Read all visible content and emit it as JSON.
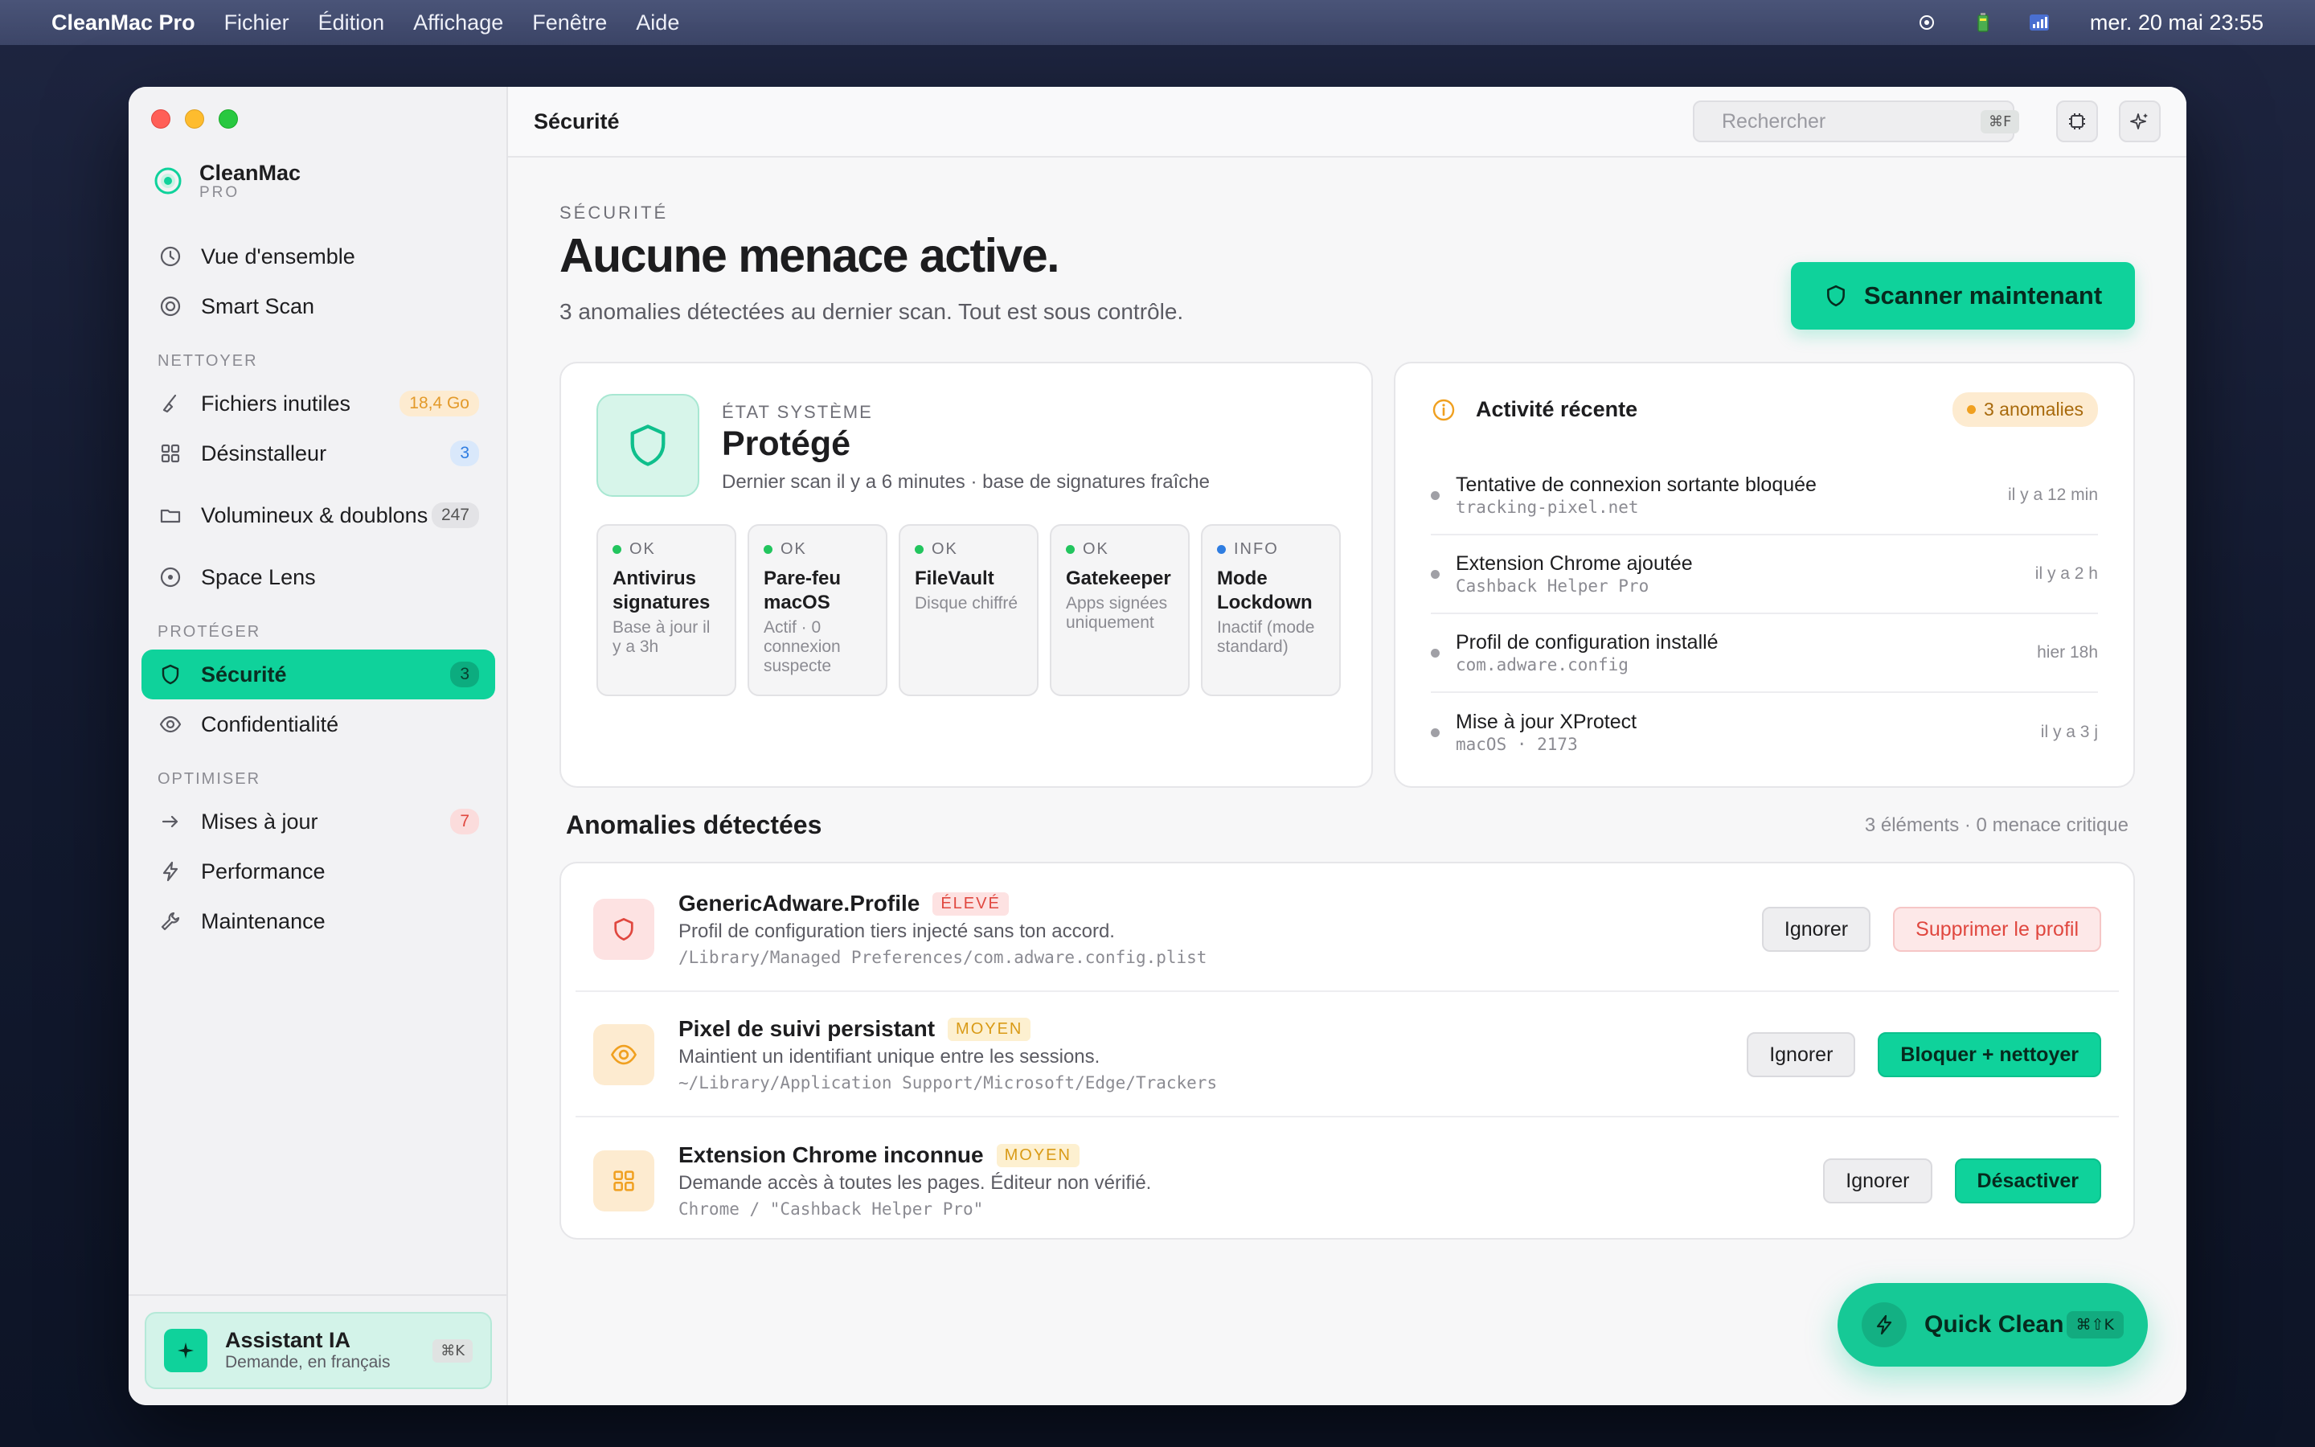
{
  "menubar": {
    "app_name": "CleanMac Pro",
    "menus": [
      "Fichier",
      "Édition",
      "Affichage",
      "Fenêtre",
      "Aide"
    ],
    "clock": "mer. 20 mai 23:55"
  },
  "sidebar": {
    "brand_name": "CleanMac",
    "brand_sub": "PRO",
    "top_items": [
      {
        "label": "Vue d'ensemble",
        "icon": "clock-icon"
      },
      {
        "label": "Smart Scan",
        "icon": "target-icon"
      }
    ],
    "sections": {
      "nettoyer": "NETTOYER",
      "proteger": "PROTÉGER",
      "optimiser": "OPTIMISER"
    },
    "clean_items": [
      {
        "label": "Fichiers inutiles",
        "badge": "18,4 Go"
      },
      {
        "label": "Désinstalleur",
        "badge": "3"
      },
      {
        "label": "Volumineux & doublons",
        "badge": "247"
      },
      {
        "label": "Space Lens",
        "badge": ""
      }
    ],
    "protect_items": [
      {
        "label": "Sécurité",
        "badge": "3",
        "active": true
      },
      {
        "label": "Confidentialité",
        "badge": ""
      }
    ],
    "optimize_items": [
      {
        "label": "Mises à jour",
        "badge": "7"
      },
      {
        "label": "Performance",
        "badge": ""
      },
      {
        "label": "Maintenance",
        "badge": ""
      }
    ],
    "assistant": {
      "title": "Assistant IA",
      "subtitle": "Demande, en français",
      "shortcut": "⌘K"
    }
  },
  "toolbar": {
    "title": "Sécurité",
    "search_placeholder": "Rechercher",
    "search_shortcut": "⌘F"
  },
  "header": {
    "eyebrow": "SÉCURITÉ",
    "headline": "Aucune menace active.",
    "subline": "3 anomalies détectées au dernier scan. Tout est sous contrôle.",
    "scan_button": "Scanner maintenant"
  },
  "system_state": {
    "eyebrow": "ÉTAT SYSTÈME",
    "title": "Protégé",
    "subtitle": "Dernier scan il y a 6 minutes · base de signatures fraîche",
    "tiles": [
      {
        "status": "OK",
        "title": "Antivirus signatures",
        "desc": "Base à jour il y a 3h",
        "color": "#22c55e"
      },
      {
        "status": "OK",
        "title": "Pare-feu macOS",
        "desc": "Actif · 0 connexion suspecte",
        "color": "#22c55e"
      },
      {
        "status": "OK",
        "title": "FileVault",
        "desc": "Disque chiffré",
        "color": "#22c55e"
      },
      {
        "status": "OK",
        "title": "Gatekeeper",
        "desc": "Apps signées uniquement",
        "color": "#22c55e"
      },
      {
        "status": "INFO",
        "title": "Mode Lockdown",
        "desc": "Inactif (mode standard)",
        "color": "#2f7de1"
      }
    ]
  },
  "activity": {
    "title": "Activité récente",
    "badge": "3 anomalies",
    "items": [
      {
        "title": "Tentative de connexion sortante bloquée",
        "meta": "tracking-pixel.net",
        "time": "il y a 12 min"
      },
      {
        "title": "Extension Chrome ajoutée",
        "meta": "Cashback Helper Pro",
        "time": "il y a 2 h"
      },
      {
        "title": "Profil de configuration installé",
        "meta": "com.adware.config",
        "time": "hier 18h"
      },
      {
        "title": "Mise à jour XProtect",
        "meta": "macOS · 2173",
        "time": "il y a 3 j"
      }
    ]
  },
  "anomalies": {
    "title": "Anomalies détectées",
    "count": "3 éléments · 0 menace critique",
    "items": [
      {
        "name": "GenericAdware.Profile",
        "severity": "ÉLEVÉ",
        "desc": "Profil de configuration tiers injecté sans ton accord.",
        "path": "/Library/Managed Preferences/com.adware.config.plist",
        "ignore": "Ignorer",
        "action": "Supprimer le profil",
        "icon": "shield-icon"
      },
      {
        "name": "Pixel de suivi persistant",
        "severity": "MOYEN",
        "desc": "Maintient un identifiant unique entre les sessions.",
        "path": "~/Library/Application Support/Microsoft/Edge/Trackers",
        "ignore": "Ignorer",
        "action": "Bloquer + nettoyer",
        "icon": "eye-icon"
      },
      {
        "name": "Extension Chrome inconnue",
        "severity": "MOYEN",
        "desc": "Demande accès à toutes les pages. Éditeur non vérifié.",
        "path": "Chrome / \"Cashback Helper Pro\"",
        "ignore": "Ignorer",
        "action": "Désactiver",
        "icon": "grid-icon"
      }
    ]
  },
  "quick_clean": {
    "label": "Quick Clean",
    "shortcut": "⌘⇧K"
  },
  "colors": {
    "accent": "#0fd29b",
    "danger": "#e0473f",
    "warning": "#f0a020"
  }
}
